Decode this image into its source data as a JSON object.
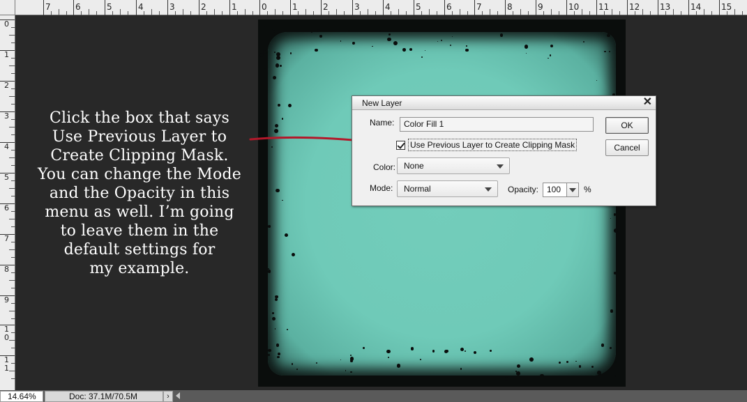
{
  "rulers": {
    "top_labels": [
      "7",
      "6",
      "5",
      "4",
      "3",
      "2",
      "1",
      "0",
      "1",
      "2",
      "3",
      "4",
      "5",
      "6",
      "7",
      "8",
      "9",
      "10",
      "11",
      "12",
      "13",
      "14",
      "15"
    ],
    "left_labels": [
      "0",
      "1",
      "2",
      "3",
      "4",
      "5",
      "6",
      "7",
      "8",
      "9",
      "1\n0",
      "1\n1"
    ]
  },
  "instructions": {
    "lines": [
      "Click the box that says",
      "Use Previous Layer to",
      "Create Clipping Mask.",
      "You can change the Mode",
      "and the Opacity in this",
      "menu as well. I’m going",
      "to leave them in the",
      "default settings for",
      "my example."
    ]
  },
  "dialog": {
    "title": "New Layer",
    "close_glyph": "✕",
    "name_label": "Name:",
    "name_value": "Color Fill 1",
    "checkbox_label": "Use Previous Layer to Create Clipping Mask",
    "checkbox_checked": true,
    "color_label": "Color:",
    "color_value": "None",
    "mode_label": "Mode:",
    "mode_value": "Normal",
    "opacity_label": "Opacity:",
    "opacity_value": "100",
    "opacity_unit": "%",
    "ok_label": "OK",
    "cancel_label": "Cancel"
  },
  "statusbar": {
    "zoom": "14.64%",
    "doc_info": "Doc: 37.1M/70.5M",
    "arrow_glyph": "›"
  },
  "colors": {
    "workspace": "#282828",
    "paper": "#6fcab8",
    "arrow": "#b3182a"
  }
}
